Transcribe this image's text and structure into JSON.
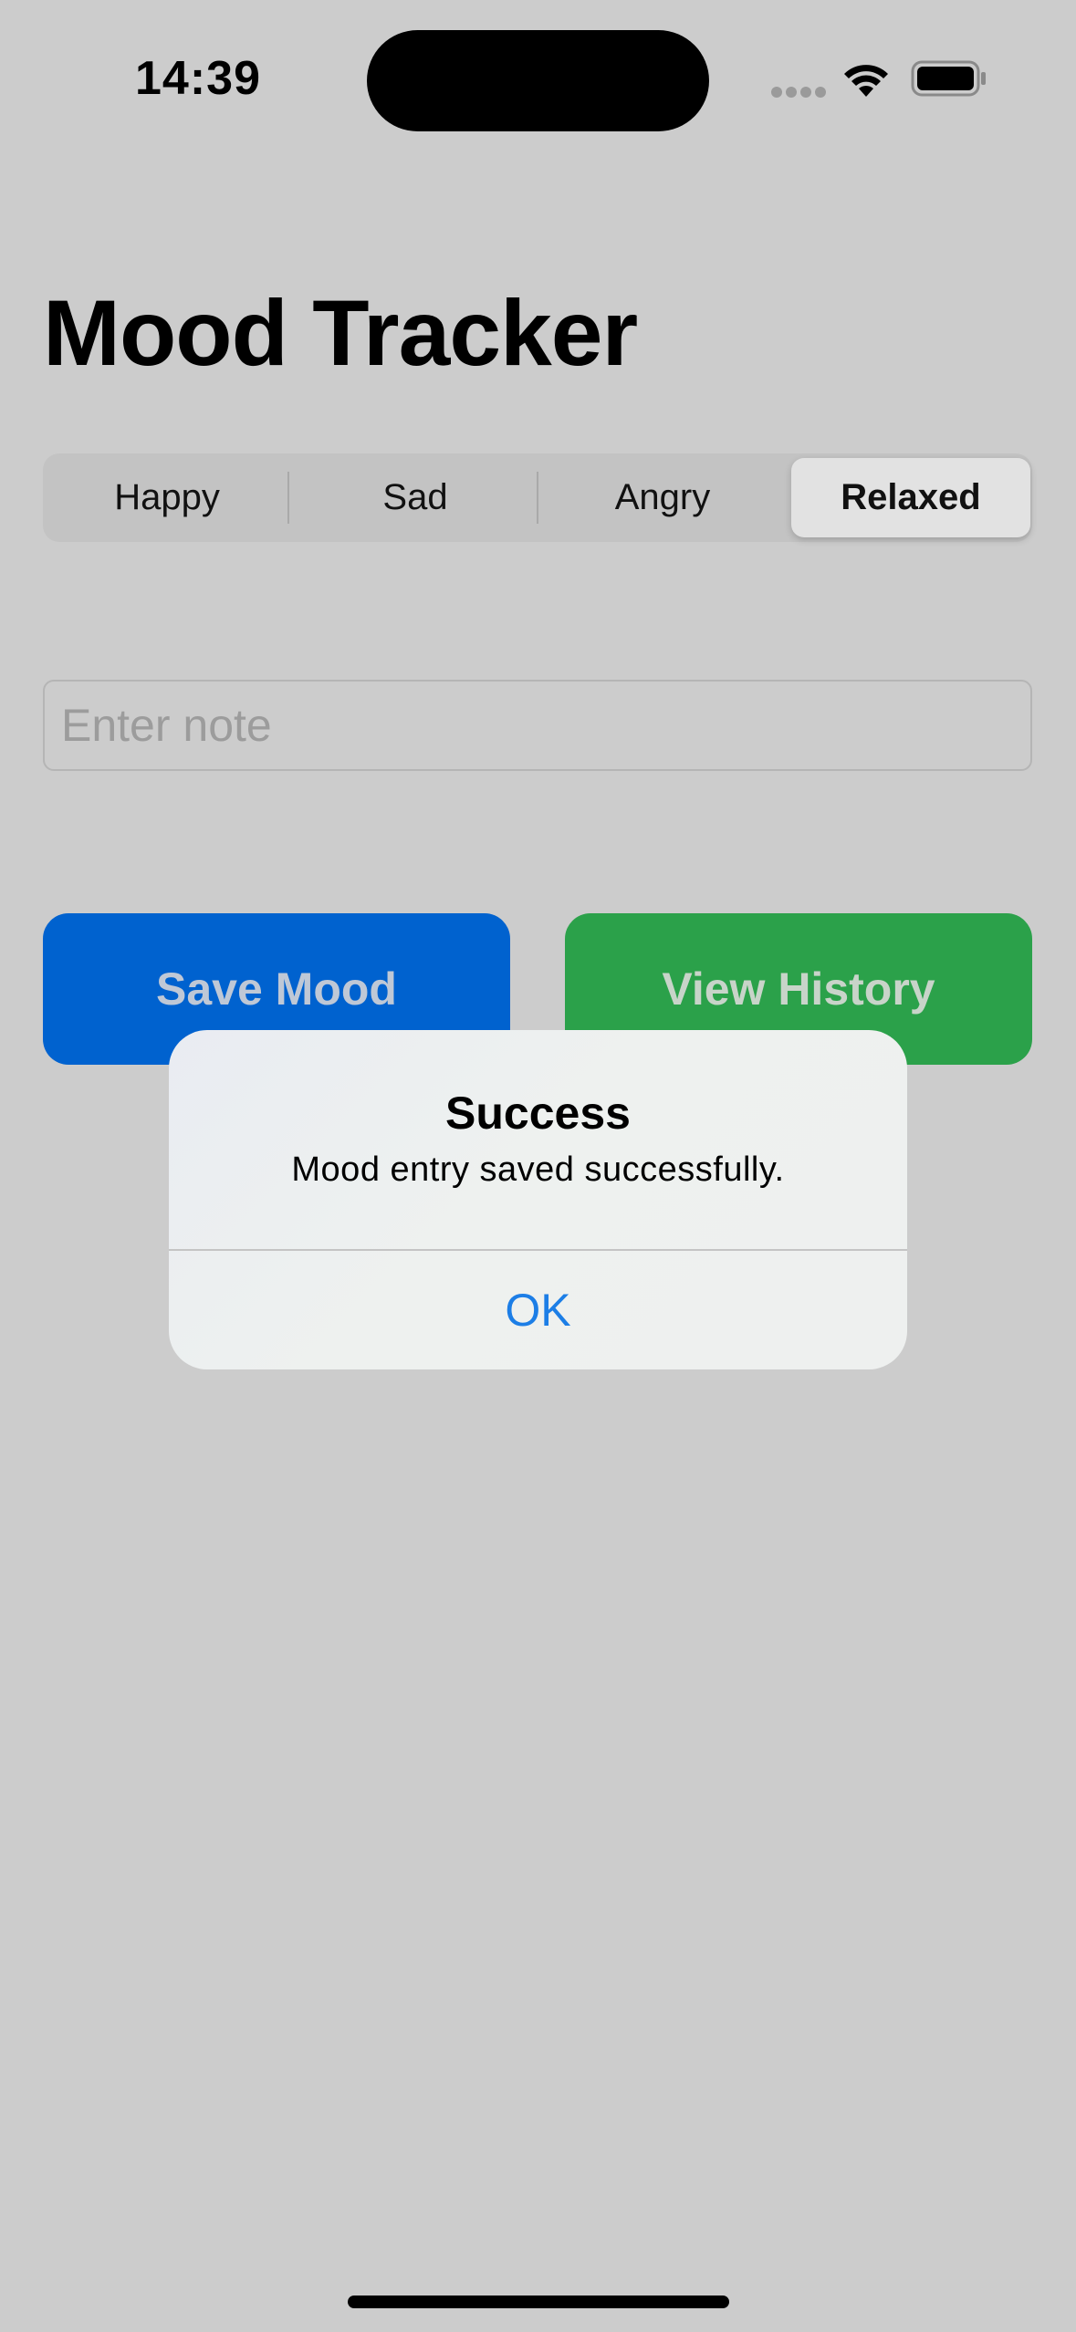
{
  "status_bar": {
    "time": "14:39",
    "icons": [
      "cellular-signal-icon",
      "wifi-icon",
      "battery-icon"
    ]
  },
  "page": {
    "title": "Mood Tracker"
  },
  "mood_selector": {
    "options": [
      "Happy",
      "Sad",
      "Angry",
      "Relaxed"
    ],
    "selected": "Relaxed"
  },
  "note": {
    "placeholder": "Enter note",
    "value": ""
  },
  "actions": {
    "save_label": "Save Mood",
    "history_label": "View History"
  },
  "alert": {
    "title": "Success",
    "message": "Mood entry saved successfully.",
    "ok_label": "OK"
  },
  "colors": {
    "background": "#cccccc",
    "save_button": "#0062cf",
    "history_button": "#2ba14a",
    "alert_action": "#1c7ee6"
  }
}
